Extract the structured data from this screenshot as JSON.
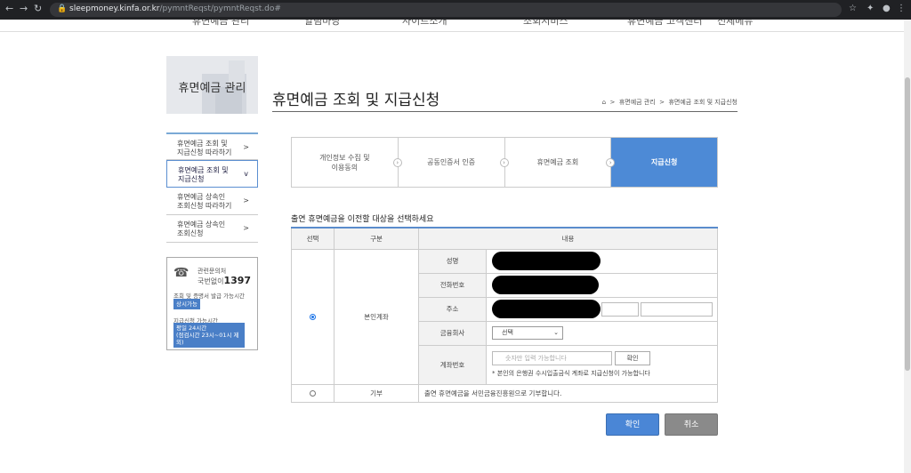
{
  "browser": {
    "url_host": "sleepmoney.kinfa.or.kr",
    "url_path": "/pymntReqst/pymntReqst.do#",
    "back_icon": "back-arrow-icon",
    "forward_icon": "forward-arrow-icon",
    "reload_icon": "reload-icon"
  },
  "topnav": {
    "items": [
      "휴면예금 관리",
      "알림마당",
      "사이트소개",
      "조회서비스",
      "휴면예금 고객센터",
      "전체메뉴"
    ]
  },
  "sidebar": {
    "title": "휴면예금 관리",
    "items": [
      {
        "label_1": "휴면예금 조회 및",
        "label_2": "지급신청 따라하기",
        "arrow": ">"
      },
      {
        "label_1": "휴면예금 조회 및",
        "label_2": "지급신청",
        "arrow": "v"
      },
      {
        "label_1": "휴면예금 상속인",
        "label_2": "조회신청 따라하기",
        "arrow": ">"
      },
      {
        "label_1": "휴면예금 상속인",
        "label_2": "조회신청",
        "arrow": ">"
      }
    ],
    "info": {
      "contact_label": "관련문의처",
      "phone_prefix": "국번없이",
      "phone_number": "1397",
      "inquiry_hours_label": "조회 및 증명서 발급 가능시간",
      "inquiry_hours": "상시가능",
      "payment_hours_label": "지급신청 가능시간",
      "payment_hours_1": "평일 24시간",
      "payment_hours_2": "(점검시간 23시~01시 제외)"
    }
  },
  "main": {
    "title": "휴면예금 조회 및 지급신청",
    "breadcrumb": [
      "휴면예금 관리",
      "휴면예금 조회 및 지급신청"
    ],
    "steps": [
      {
        "label_1": "개인정보 수집 및",
        "label_2": "이용동의"
      },
      {
        "label_1": "공동인증서 인증",
        "label_2": ""
      },
      {
        "label_1": "휴면예금 조회",
        "label_2": ""
      },
      {
        "label_1": "지급신청",
        "label_2": ""
      }
    ],
    "instruction": "출연 휴면예금을 이전할 대상을 선택하세요",
    "table": {
      "headers": [
        "선택",
        "구분",
        "내용"
      ],
      "row1_type": "본인계좌",
      "fields": {
        "name": "성명",
        "phone": "전화번호",
        "address": "주소",
        "bank": "금융회사",
        "account": "계좌번호"
      },
      "bank_select": "선택",
      "account_placeholder": "숫자만 입력 가능합니다",
      "confirm_small": "확인",
      "account_note": "* 본인의 은행권 수시입출금식 계좌로 지급신청이 가능합니다",
      "row2_type": "기부",
      "row2_content": "출연 휴면예금을 서민금융진흥원으로 기부합니다."
    },
    "confirm_button": "확인",
    "cancel_button": "취소"
  }
}
